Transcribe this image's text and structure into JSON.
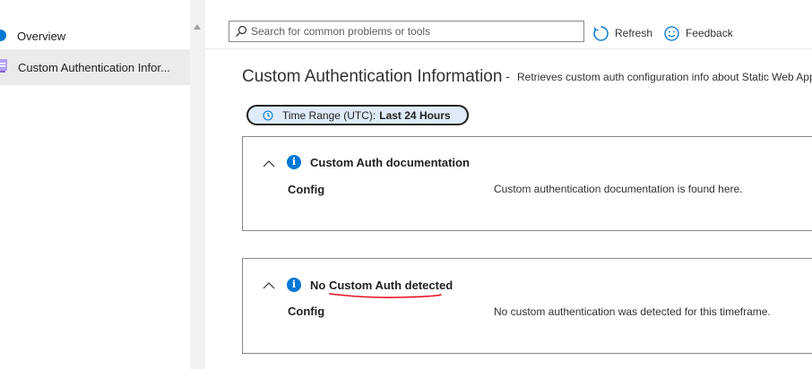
{
  "sidebar": {
    "items": [
      {
        "label": "Overview",
        "icon": "info-icon"
      },
      {
        "label": "Custom Authentication Infor...",
        "icon": "custom-auth-icon"
      }
    ]
  },
  "toolbar": {
    "search_placeholder": "Search for common problems or tools",
    "refresh_label": "Refresh",
    "feedback_label": "Feedback"
  },
  "header": {
    "title": "Custom Authentication Information",
    "separator": "-",
    "description": "Retrieves custom auth configuration info about Static Web Apps"
  },
  "time_range": {
    "prefix": "Time Range (UTC):",
    "value": "Last 24 Hours"
  },
  "cards": [
    {
      "title": "Custom Auth documentation",
      "row_label": "Config",
      "row_value": "Custom authentication documentation is found here."
    },
    {
      "title": "No Custom Auth detected",
      "row_label": "Config",
      "row_value": "No custom authentication was detected for this timeframe."
    }
  ],
  "colors": {
    "accent": "#0078d4",
    "annotation": "#e81123",
    "pill_bg": "#deecf9"
  }
}
